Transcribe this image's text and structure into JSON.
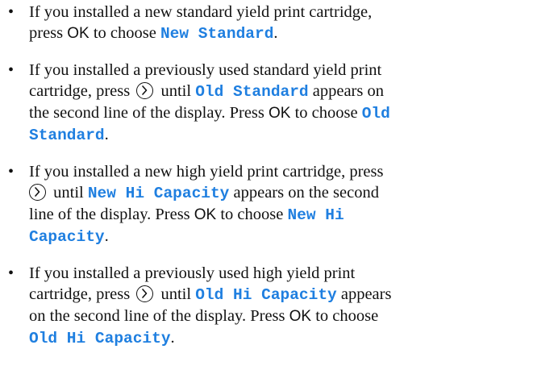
{
  "bullet": "•",
  "items": [
    {
      "t1": "If you installed a new standard yield print cartridge,",
      "t2": "press",
      "ok": "OK",
      "t3": "to choose",
      "code": "New Standard",
      "end": "."
    },
    {
      "t1": "If you installed a previously used standard yield print",
      "t2": "cartridge, press",
      "code1": "Old Standard",
      "t3": "appears on",
      "t4": "the second line of the display. Press",
      "ok": "OK",
      "t5": "to choose",
      "code2a": "Old",
      "code2b": "Standard",
      "end": "."
    },
    {
      "t1": "If you installed a new high yield print cartridge, press",
      "code1": "New Hi Capacity",
      "t2": "appears on the second",
      "t3": "line of the display. Press",
      "ok": "OK",
      "t4": "to choose",
      "code2a": "New Hi",
      "code2b": "Capacity",
      "end": "."
    },
    {
      "t1": "If you installed a previously used high yield print",
      "t2": "cartridge, press",
      "code1": "Old Hi Capacity",
      "t3": "appears",
      "t4": "on the second line of the display. Press",
      "ok": "OK",
      "t5": "to choose",
      "code2": "Old Hi Capacity",
      "end": "."
    }
  ],
  "common": {
    "until": "until"
  },
  "colors": {
    "code_text": "#1f7fe0",
    "body_text": "#111111"
  },
  "icons": {
    "arrow_button": "right-arrow-button-icon"
  }
}
